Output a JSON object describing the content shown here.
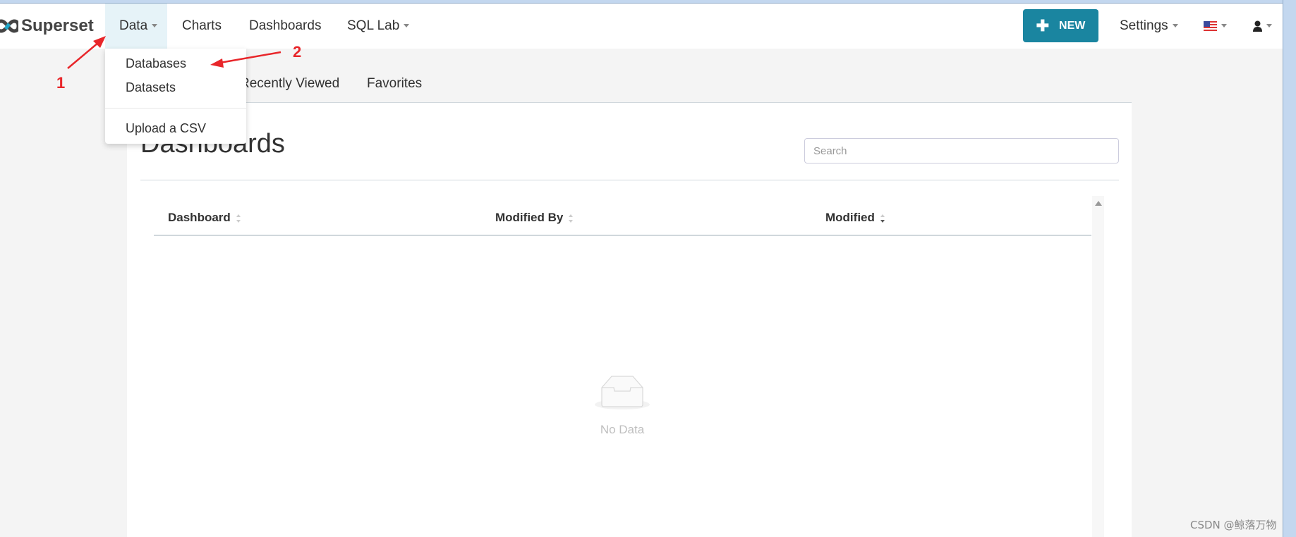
{
  "navbar": {
    "brand": "Superset",
    "items": [
      {
        "label": "Data",
        "has_caret": true,
        "active": true
      },
      {
        "label": "Charts"
      },
      {
        "label": "Dashboards"
      },
      {
        "label": "SQL Lab",
        "has_caret": true
      }
    ],
    "new_button": "NEW",
    "settings": "Settings",
    "language_icon": "us-flag-icon",
    "user_icon": "user-icon",
    "accent_color": "#1a85a0"
  },
  "data_menu": {
    "items": [
      "Databases",
      "Datasets"
    ],
    "upload": "Upload a CSV"
  },
  "tabs": [
    "Recently Viewed",
    "Favorites"
  ],
  "main": {
    "title": "Dashboards",
    "search_placeholder": "Search",
    "columns": [
      "Dashboard",
      "Modified By",
      "Modified"
    ],
    "empty_text": "No Data"
  },
  "annotations": {
    "step1": "1",
    "step2": "2",
    "color": "#e8262a"
  },
  "watermark": "CSDN @鲸落万物"
}
